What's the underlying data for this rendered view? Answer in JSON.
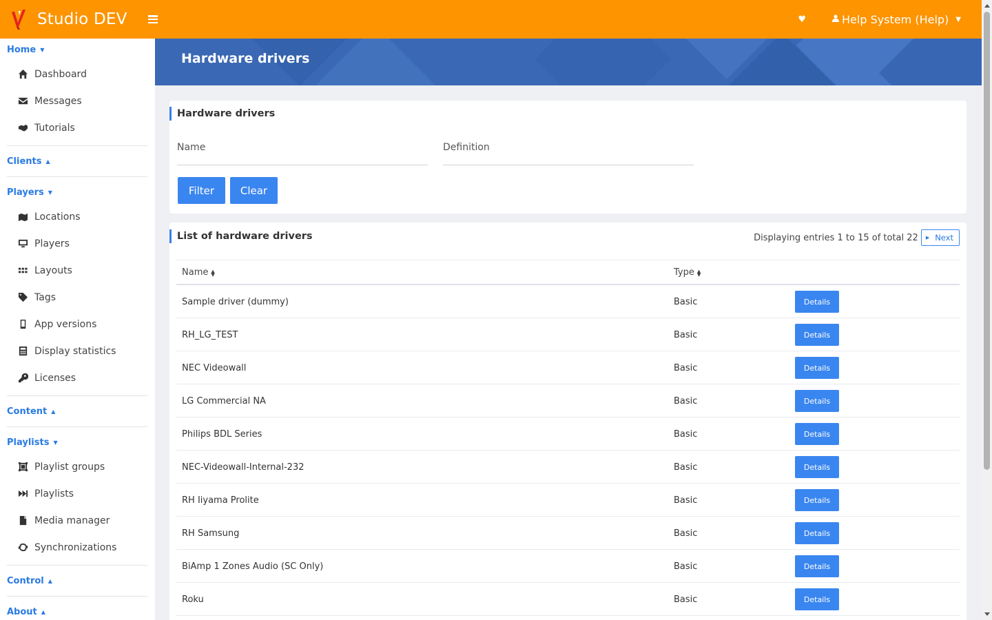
{
  "app": {
    "title": "Studio DEV",
    "user_label": "Help System (Help)",
    "brand_color": "#fd9400",
    "accent_color": "#3a86f0"
  },
  "sidebar": {
    "sections": [
      {
        "label": "Home",
        "expanded": true,
        "items": [
          {
            "label": "Dashboard",
            "icon": "home-icon"
          },
          {
            "label": "Messages",
            "icon": "envelope-icon"
          },
          {
            "label": "Tutorials",
            "icon": "handshake-icon"
          }
        ]
      },
      {
        "label": "Clients",
        "expanded": false,
        "items": []
      },
      {
        "label": "Players",
        "expanded": true,
        "items": [
          {
            "label": "Locations",
            "icon": "map-marker-icon"
          },
          {
            "label": "Players",
            "icon": "desktop-icon"
          },
          {
            "label": "Layouts",
            "icon": "grid-icon"
          },
          {
            "label": "Tags",
            "icon": "tag-icon"
          },
          {
            "label": "App versions",
            "icon": "mobile-icon"
          },
          {
            "label": "Display statistics",
            "icon": "calculator-icon"
          },
          {
            "label": "Licenses",
            "icon": "key-icon"
          }
        ]
      },
      {
        "label": "Content",
        "expanded": false,
        "items": []
      },
      {
        "label": "Playlists",
        "expanded": true,
        "items": [
          {
            "label": "Playlist groups",
            "icon": "object-group-icon"
          },
          {
            "label": "Playlists",
            "icon": "fast-forward-icon"
          },
          {
            "label": "Media manager",
            "icon": "file-icon"
          },
          {
            "label": "Synchronizations",
            "icon": "sync-icon"
          }
        ]
      },
      {
        "label": "Control",
        "expanded": false,
        "items": []
      },
      {
        "label": "About",
        "expanded": false,
        "items": []
      }
    ]
  },
  "banner": {
    "title": "Hardware drivers"
  },
  "filter": {
    "title": "Hardware drivers",
    "name_placeholder": "Name",
    "definition_placeholder": "Definition",
    "filter_label": "Filter",
    "clear_label": "Clear"
  },
  "list": {
    "title": "List of hardware drivers",
    "paging_text": "Displaying entries 1 to 15 of total 22",
    "next_label": "Next",
    "columns": {
      "name": "Name",
      "type": "Type"
    },
    "details_label": "Details",
    "rows": [
      {
        "name": "Sample driver (dummy)",
        "type": "Basic"
      },
      {
        "name": "RH_LG_TEST",
        "type": "Basic"
      },
      {
        "name": "NEC Videowall",
        "type": "Basic"
      },
      {
        "name": "LG Commercial NA",
        "type": "Basic"
      },
      {
        "name": "Philips BDL Series",
        "type": "Basic"
      },
      {
        "name": "NEC-Videowall-Internal-232",
        "type": "Basic"
      },
      {
        "name": "RH Iiyama Prolite",
        "type": "Basic"
      },
      {
        "name": "RH Samsung",
        "type": "Basic"
      },
      {
        "name": "BiAmp 1 Zones Audio (SC Only)",
        "type": "Basic"
      },
      {
        "name": "Roku",
        "type": "Basic"
      },
      {
        "name": "",
        "type": ""
      }
    ]
  }
}
